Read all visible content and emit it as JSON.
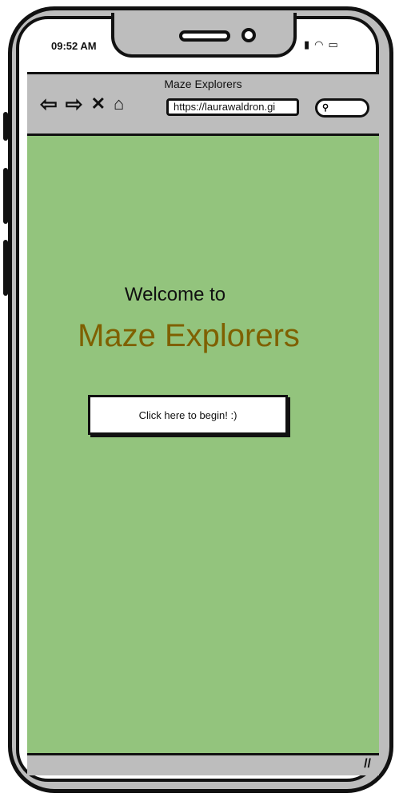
{
  "status_bar": {
    "time": "09:52 AM"
  },
  "browser": {
    "title": "Maze Explorers",
    "url": "https://laurawaldron.gi",
    "icons": [
      "back-arrow-icon",
      "forward-arrow-icon",
      "close-icon",
      "home-icon",
      "search-icon"
    ]
  },
  "page": {
    "welcome_text": "Welcome to",
    "app_name": "Maze Explorers",
    "begin_button_label": "Click here to begin! :)"
  },
  "colors": {
    "background": "#93c47d",
    "app_name": "#7f6000",
    "chrome": "#bdbdbd"
  }
}
